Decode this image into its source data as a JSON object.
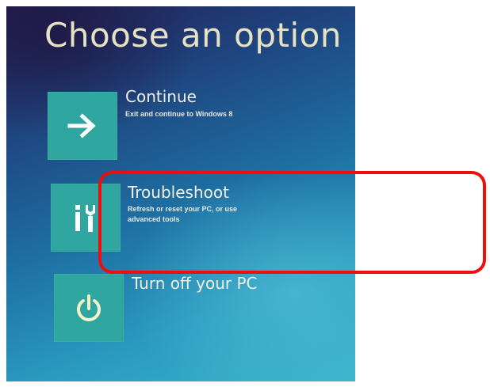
{
  "screen": {
    "title": "Choose an option"
  },
  "options": [
    {
      "title": "Continue",
      "description": "Exit and continue to Windows 8",
      "icon": "arrow-right-icon"
    },
    {
      "title": "Troubleshoot",
      "description": "Refresh or reset your PC, or use advanced tools",
      "icon": "tools-icon"
    },
    {
      "title": "Turn off your PC",
      "description": "",
      "icon": "power-icon"
    }
  ],
  "annotation": {
    "highlight_color": "#ef0d0d",
    "highlighted_option": "Troubleshoot"
  },
  "colors": {
    "tile": "#2fa6a0",
    "title_text": "#e7e2c4",
    "background_top": "#241f52",
    "background_bottom": "#3bb3cc"
  }
}
